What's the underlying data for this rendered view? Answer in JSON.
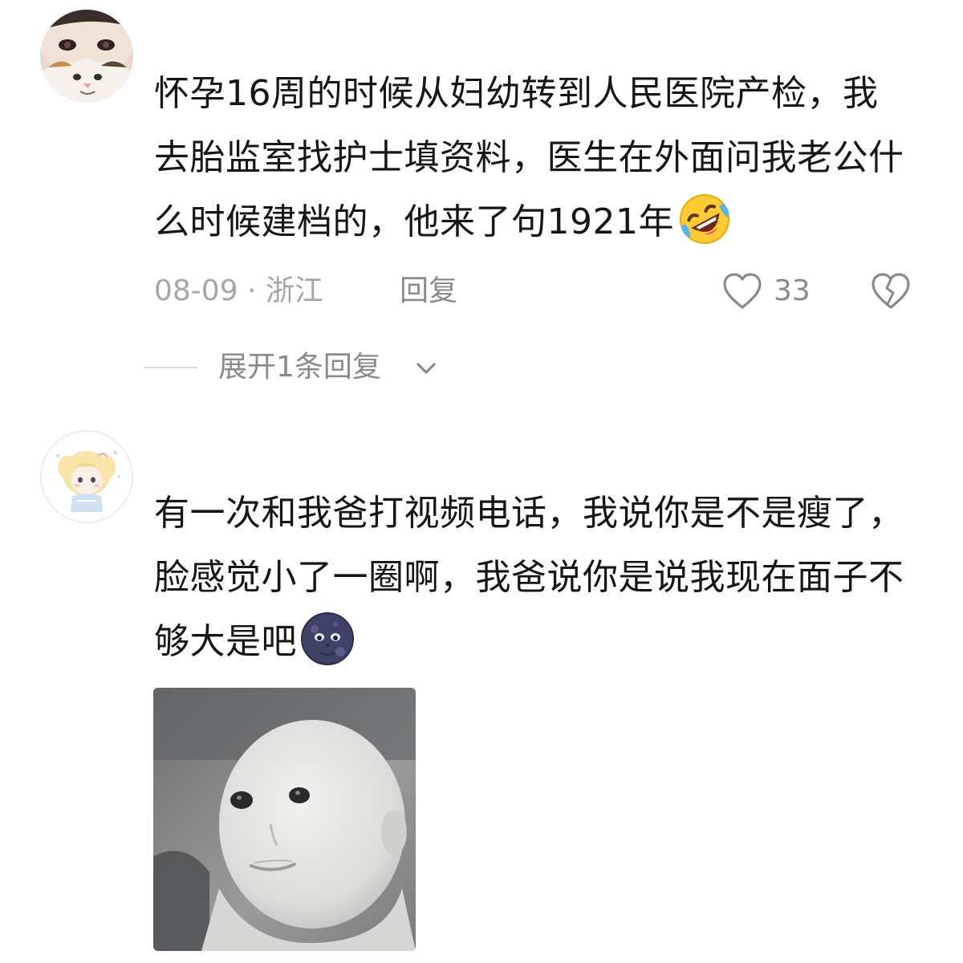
{
  "comments": [
    {
      "text": "怀孕16周的时候从妇幼转到人民医院产检，我去胎监室找护士填资料，医生在外面问我老公什么时候建档的，他来了句1921年",
      "emoji": "rolling-on-floor-laughing-icon",
      "date": "08-09 · 浙江",
      "reply_label": "回复",
      "likes": "33",
      "expand_label": "展开1条回复"
    },
    {
      "text": "有一次和我爸打视频电话，我说你是不是瘦了，脸感觉小了一圈啊，我爸说你是说我现在面子不够大是吧",
      "emoji": "new-moon-face-icon"
    }
  ],
  "colors": {
    "text": "#161616",
    "meta": "#a6a6a6",
    "divider": "#d9d9d9"
  }
}
